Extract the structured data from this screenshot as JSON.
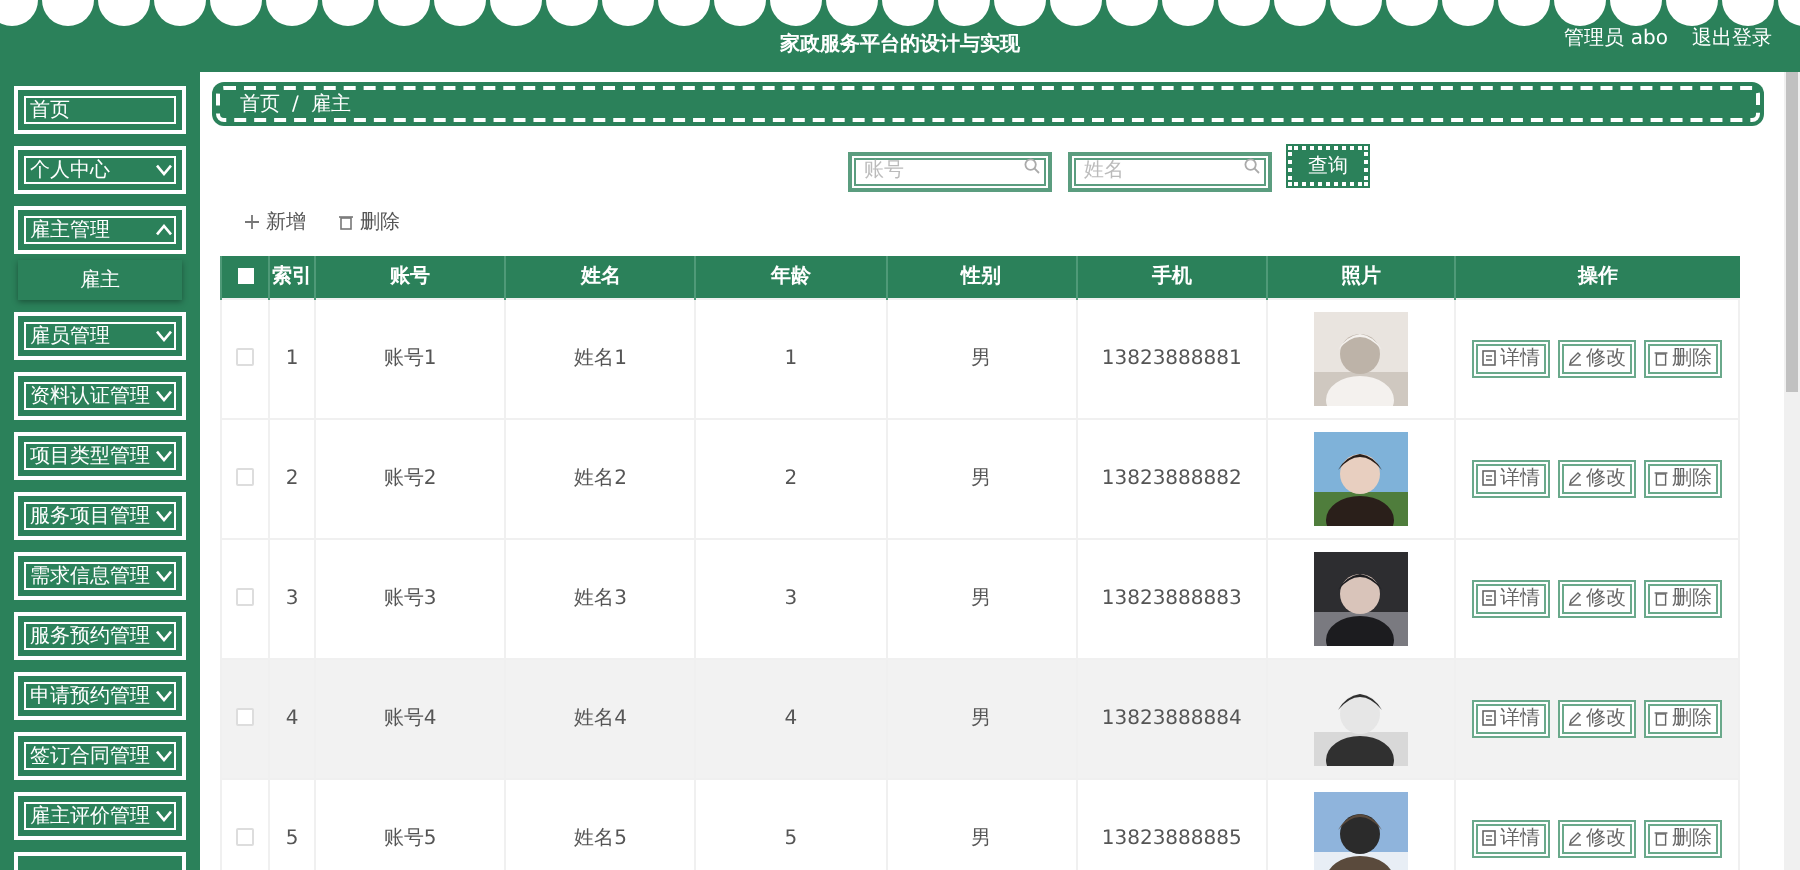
{
  "header": {
    "title": "家政服务平台的设计与实现",
    "user": "管理员 abo",
    "logout": "退出登录"
  },
  "sidebar": {
    "items": [
      {
        "label": "首页",
        "kind": "link"
      },
      {
        "label": "个人中心",
        "kind": "menu",
        "expanded": false
      },
      {
        "label": "雇主管理",
        "kind": "menu",
        "expanded": true,
        "children": [
          {
            "label": "雇主"
          }
        ]
      },
      {
        "label": "雇员管理",
        "kind": "menu",
        "expanded": false
      },
      {
        "label": "资料认证管理",
        "kind": "menu",
        "expanded": false
      },
      {
        "label": "项目类型管理",
        "kind": "menu",
        "expanded": false
      },
      {
        "label": "服务项目管理",
        "kind": "menu",
        "expanded": false
      },
      {
        "label": "需求信息管理",
        "kind": "menu",
        "expanded": false
      },
      {
        "label": "服务预约管理",
        "kind": "menu",
        "expanded": false
      },
      {
        "label": "申请预约管理",
        "kind": "menu",
        "expanded": false
      },
      {
        "label": "签订合同管理",
        "kind": "menu",
        "expanded": false
      },
      {
        "label": "雇主评价管理",
        "kind": "menu",
        "expanded": false
      }
    ]
  },
  "breadcrumb": {
    "items": [
      "首页",
      "雇主"
    ],
    "separator": "/"
  },
  "search": {
    "fields": [
      {
        "placeholder": "账号"
      },
      {
        "placeholder": "姓名"
      }
    ],
    "button": "查询"
  },
  "actions": [
    {
      "label": "新增",
      "kind": "add"
    },
    {
      "label": "删除",
      "kind": "delete"
    }
  ],
  "table": {
    "columns": [
      "索引",
      "账号",
      "姓名",
      "年龄",
      "性别",
      "手机",
      "照片",
      "操作"
    ],
    "header_checked": false,
    "rows": [
      {
        "index": "1",
        "account": "账号1",
        "name": "姓名1",
        "age": "1",
        "gender": "男",
        "phone": "13823888881",
        "checked": false,
        "highlighted": false,
        "actions": [
          {
            "label": "详情",
            "kind": "detail"
          },
          {
            "label": "修改",
            "kind": "edit"
          },
          {
            "label": "删除",
            "kind": "delete"
          }
        ]
      },
      {
        "index": "2",
        "account": "账号2",
        "name": "姓名2",
        "age": "2",
        "gender": "男",
        "phone": "13823888882",
        "checked": false,
        "highlighted": false,
        "actions": [
          {
            "label": "详情",
            "kind": "detail"
          },
          {
            "label": "修改",
            "kind": "edit"
          },
          {
            "label": "删除",
            "kind": "delete"
          }
        ]
      },
      {
        "index": "3",
        "account": "账号3",
        "name": "姓名3",
        "age": "3",
        "gender": "男",
        "phone": "13823888883",
        "checked": false,
        "highlighted": false,
        "actions": [
          {
            "label": "详情",
            "kind": "detail"
          },
          {
            "label": "修改",
            "kind": "edit"
          },
          {
            "label": "删除",
            "kind": "delete"
          }
        ]
      },
      {
        "index": "4",
        "account": "账号4",
        "name": "姓名4",
        "age": "4",
        "gender": "男",
        "phone": "13823888884",
        "checked": false,
        "highlighted": true,
        "actions": [
          {
            "label": "详情",
            "kind": "detail"
          },
          {
            "label": "修改",
            "kind": "edit"
          },
          {
            "label": "删除",
            "kind": "delete"
          }
        ]
      },
      {
        "index": "5",
        "account": "账号5",
        "name": "姓名5",
        "age": "5",
        "gender": "男",
        "phone": "13823888885",
        "checked": false,
        "highlighted": false,
        "actions": [
          {
            "label": "详情",
            "kind": "detail"
          },
          {
            "label": "修改",
            "kind": "edit"
          },
          {
            "label": "删除",
            "kind": "delete"
          }
        ]
      }
    ]
  }
}
